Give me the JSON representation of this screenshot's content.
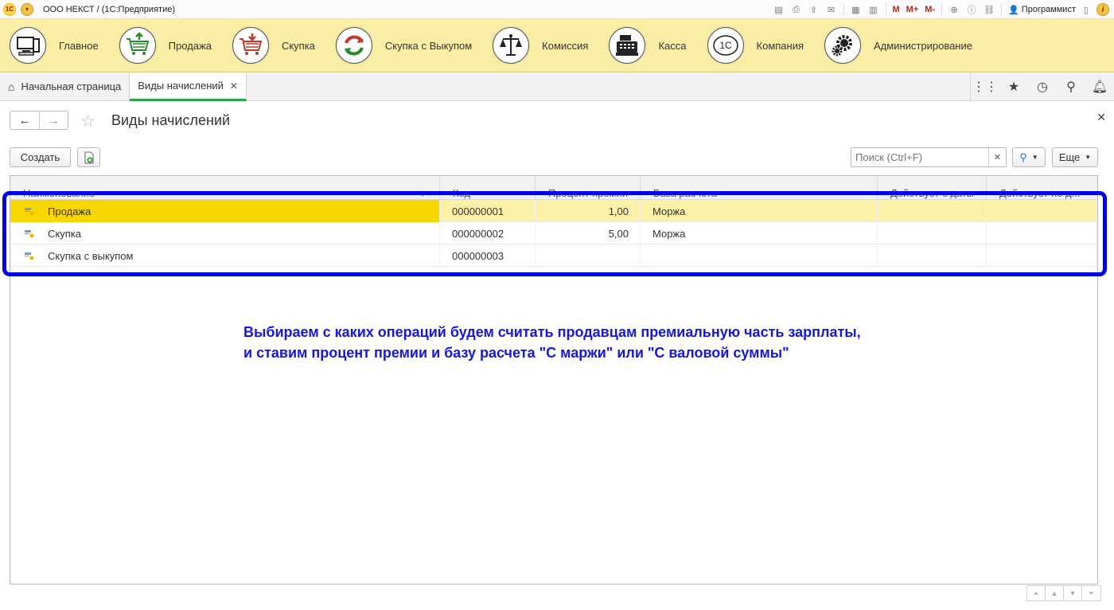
{
  "titlebar": {
    "logo": "1С",
    "title": "ООО НЕКСТ /   (1С:Предприятие)",
    "memory_buttons": [
      "M",
      "M+",
      "M-"
    ],
    "user": "Программист"
  },
  "sections": [
    {
      "label": "Главное",
      "icon": "computer-icon"
    },
    {
      "label": "Продажа",
      "icon": "cart-up-icon"
    },
    {
      "label": "Скупка",
      "icon": "cart-down-icon"
    },
    {
      "label": "Скупка с Выкупом",
      "icon": "cycle-arrows-icon"
    },
    {
      "label": "Комиссия",
      "icon": "scales-icon"
    },
    {
      "label": "Касса",
      "icon": "cash-register-icon"
    },
    {
      "label": "Компания",
      "icon": "company-logo-icon"
    },
    {
      "label": "Администрирование",
      "icon": "gears-icon"
    }
  ],
  "company_logo_text": "1С",
  "tabs": {
    "home": "Начальная страница",
    "active": "Виды начислений"
  },
  "form": {
    "title": "Виды начислений",
    "create_label": "Создать",
    "search_placeholder": "Поиск (Ctrl+F)",
    "more_label": "Еще"
  },
  "table": {
    "columns": [
      "Наименование",
      "Код",
      "Процент премии",
      "База расчета",
      "Действует с даты",
      "Действует по д..."
    ],
    "rows": [
      {
        "name": "Продажа",
        "code": "000000001",
        "percent": "1,00",
        "base": "Моржа",
        "from": "",
        "to": ""
      },
      {
        "name": "Скупка",
        "code": "000000002",
        "percent": "5,00",
        "base": "Моржа",
        "from": "",
        "to": ""
      },
      {
        "name": "Скупка с выкупом",
        "code": "000000003",
        "percent": "",
        "base": "",
        "from": "",
        "to": ""
      }
    ]
  },
  "annotation": {
    "line1": "Выбираем с каких операций будем считать продавцам премиальную часть зарплаты,",
    "line2": "и ставим процент премии и базу расчета \"С маржи\" или \"С валовой суммы\""
  },
  "colors": {
    "section_bg": "#faeea6",
    "selected_row": "#fbf1a8",
    "focused_cell": "#f8d700",
    "highlight_border": "#0000e6",
    "annotation_text": "#1515e6",
    "active_tab_underline": "#28a745"
  }
}
